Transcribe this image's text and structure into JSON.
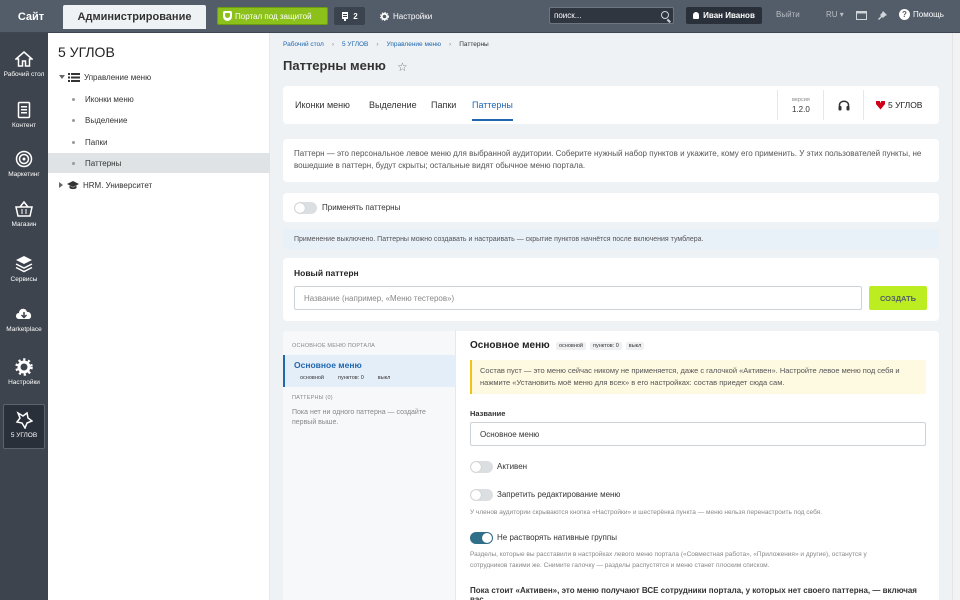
{
  "topbar": {
    "site": "Сайт",
    "admin": "Администрирование",
    "portal": "Портал под защитой",
    "notif_count": "2",
    "settings": "Настройки",
    "search": "поиск...",
    "user": "Иван Иванов",
    "logout": "Выйти",
    "lang": "RU",
    "help": "Помощь"
  },
  "leftnav": [
    {
      "label": "Рабочий стол",
      "icon": "home-icon"
    },
    {
      "label": "Контент",
      "icon": "document-icon"
    },
    {
      "label": "Маркетинг",
      "icon": "target-icon"
    },
    {
      "label": "Магазин",
      "icon": "basket-icon"
    },
    {
      "label": "Сервисы",
      "icon": "layers-icon"
    },
    {
      "label": "Marketplace",
      "icon": "cloud-download-icon"
    },
    {
      "label": "Настройки",
      "icon": "gear-icon"
    },
    {
      "label": "5 УГЛОВ",
      "icon": "star-icon"
    }
  ],
  "tree": {
    "title": "5 УГЛОВ",
    "items": [
      "Управление меню",
      "Иконки меню",
      "Выделение",
      "Папки",
      "Паттерны",
      "HRM. Университет"
    ]
  },
  "breadcrumb": [
    "Рабочий стол",
    "5 УГЛОВ",
    "Управление меню",
    "Паттерны"
  ],
  "page_title": "Паттерны меню",
  "tabs": [
    "Иконки меню",
    "Выделение",
    "Папки",
    "Паттерны"
  ],
  "version": {
    "label": "версия",
    "value": "1.2.0"
  },
  "brand": "5 УГЛОВ",
  "intro": "Паттерн — это персональное левое меню для выбранной аудитории. Соберите нужный набор пунктов и укажите, кому его применить. У этих пользователей пункты, не вошедшие в паттерн, будут скрыты; остальные видят обычное меню портала.",
  "apply_toggle": "Применять паттерны",
  "info": "Применение выключено. Паттерны можно создавать и настраивать — скрытие пунктов начнётся после включения тумблера.",
  "new_pattern": {
    "title": "Новый паттерн",
    "placeholder": "Название (например, «Меню тестеров»)",
    "button": "СОЗДАТЬ"
  },
  "sidebar": {
    "section_main": "ОСНОВНОЕ МЕНЮ ПОРТАЛА",
    "main_name": "Основное меню",
    "main_tags": [
      "основной",
      "пунктов: 0",
      "выкл"
    ],
    "section_patterns": "ПАТТЕРНЫ (0)",
    "empty": "Пока нет ни одного паттерна — создайте первый выше."
  },
  "editor": {
    "title": "Основное меню",
    "tags": [
      "основной",
      "пунктов: 0",
      "выкл"
    ],
    "warning": "Состав пуст — это меню сейчас никому не применяется, даже с галочкой «Активен». Настройте левое меню под себя и нажмите «Установить моё меню для всех» в его настройках: состав приедет сюда сам.",
    "name_label": "Название",
    "name_value": "Основное меню",
    "active_label": "Активен",
    "active_on": false,
    "lock_label": "Запретить редактирование меню",
    "lock_on": false,
    "lock_help": "У членов аудитории скрываются кнопка «Настройки» и шестерёнка пункта — меню нельзя перенастроить под себя.",
    "native_label": "Не растворять нативные группы",
    "native_on": true,
    "native_help1": "Разделы, которые вы расставили в настройках левого меню портала («Совместная работа», «Приложения» и другие), останутся у",
    "native_help2": "сотрудников такими же. Снимите галочку — разделы распустятся и меню станет плоским списком.",
    "bottom": "Пока стоит «Активен», это меню получают ВСЕ сотрудники портала, у которых нет своего паттерна, — включая вас."
  }
}
